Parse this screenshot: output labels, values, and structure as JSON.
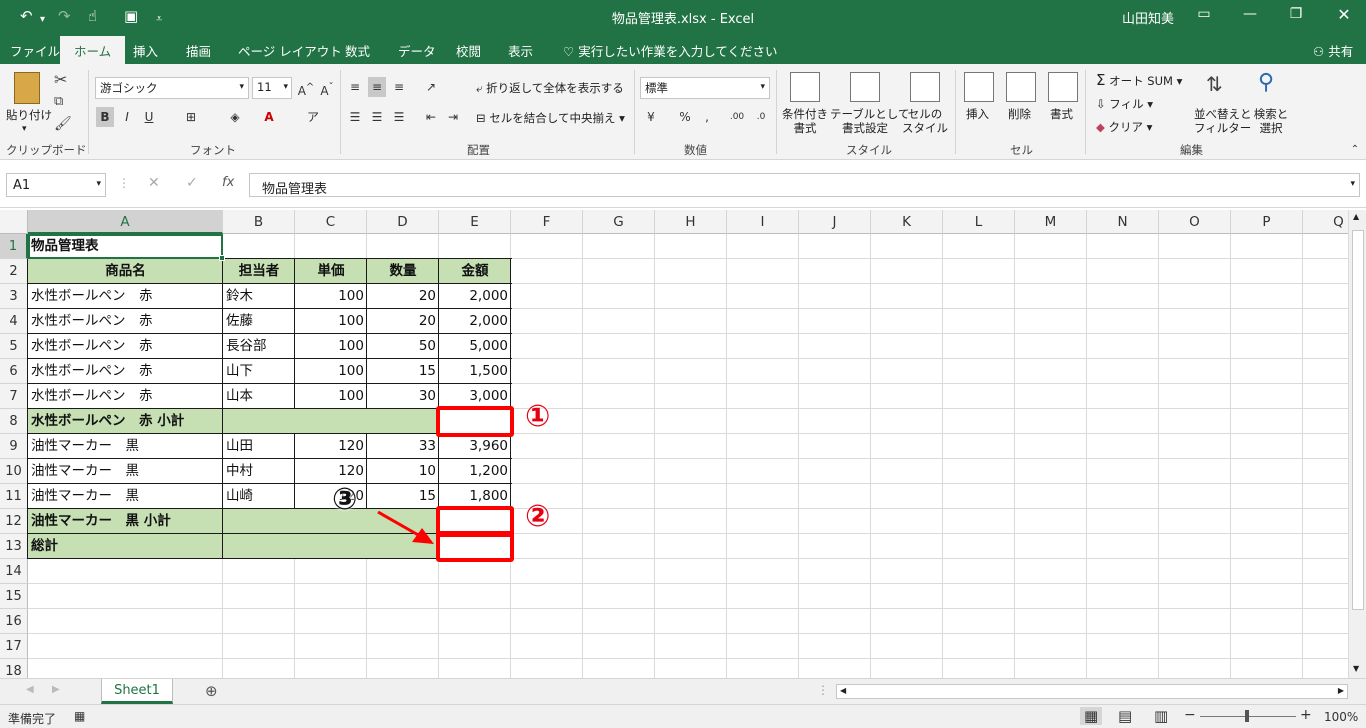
{
  "window": {
    "title": "物品管理表.xlsx  -  Excel",
    "user": "山田知美"
  },
  "tabs": {
    "items": [
      "ファイル",
      "ホーム",
      "挿入",
      "描画",
      "ページ レイアウト",
      "数式",
      "データ",
      "校閲",
      "表示"
    ],
    "active": "ホーム",
    "tell_me": "実行したい作業を入力してください",
    "share": "共有"
  },
  "ribbon": {
    "clipboard": {
      "paste": "貼り付け",
      "label": "クリップボード"
    },
    "font": {
      "name": "游ゴシック",
      "size": "11",
      "label": "フォント"
    },
    "alignment": {
      "wrap": "折り返して全体を表示する",
      "merge": "セルを結合して中央揃え",
      "label": "配置"
    },
    "number": {
      "format": "標準",
      "label": "数値"
    },
    "styles": {
      "conditional": [
        "条件付き",
        "書式"
      ],
      "table": [
        "テーブルとして",
        "書式設定"
      ],
      "cell": [
        "セルの",
        "スタイル"
      ],
      "label": "スタイル"
    },
    "cells": {
      "insert": "挿入",
      "delete": "削除",
      "format": "書式",
      "label": "セル"
    },
    "editing": {
      "autosum": "オート SUM",
      "fill": "フィル",
      "clear": "クリア",
      "sort": [
        "並べ替えと",
        "フィルター"
      ],
      "find": [
        "検索と",
        "選択"
      ],
      "label": "編集"
    }
  },
  "formula_bar": {
    "name_box": "A1",
    "content": "物品管理表"
  },
  "columns": [
    "A",
    "B",
    "C",
    "D",
    "E",
    "F",
    "G",
    "H",
    "I",
    "J",
    "K",
    "L",
    "M",
    "N",
    "O",
    "P",
    "Q"
  ],
  "rows": [
    "1",
    "2",
    "3",
    "4",
    "5",
    "6",
    "7",
    "8",
    "9",
    "10",
    "11",
    "12",
    "13",
    "14",
    "15",
    "16",
    "17",
    "18"
  ],
  "sheet": {
    "title": "物品管理表",
    "headers": [
      "商品名",
      "担当者",
      "単価",
      "数量",
      "金額"
    ],
    "records": [
      {
        "item": "水性ボールペン　赤",
        "person": "鈴木",
        "price": "100",
        "qty": "20",
        "amount": "2,000"
      },
      {
        "item": "水性ボールペン　赤",
        "person": "佐藤",
        "price": "100",
        "qty": "20",
        "amount": "2,000"
      },
      {
        "item": "水性ボールペン　赤",
        "person": "長谷部",
        "price": "100",
        "qty": "50",
        "amount": "5,000"
      },
      {
        "item": "水性ボールペン　赤",
        "person": "山下",
        "price": "100",
        "qty": "15",
        "amount": "1,500"
      },
      {
        "item": "水性ボールペン　赤",
        "person": "山本",
        "price": "100",
        "qty": "30",
        "amount": "3,000"
      },
      {
        "item": "水性ボールペン　赤 小計",
        "person": "",
        "price": "",
        "qty": "",
        "amount": ""
      },
      {
        "item": "油性マーカー　黒",
        "person": "山田",
        "price": "120",
        "qty": "33",
        "amount": "3,960"
      },
      {
        "item": "油性マーカー　黒",
        "person": "中村",
        "price": "120",
        "qty": "10",
        "amount": "1,200"
      },
      {
        "item": "油性マーカー　黒",
        "person": "山崎",
        "price": "120",
        "qty": "15",
        "amount": "1,800"
      },
      {
        "item": "油性マーカー　黒 小計",
        "person": "",
        "price": "",
        "qty": "",
        "amount": ""
      },
      {
        "item": "総計",
        "person": "",
        "price": "",
        "qty": "",
        "amount": ""
      }
    ]
  },
  "annotations": {
    "one": "①",
    "two": "②",
    "three": "③"
  },
  "sheet_tab": "Sheet1",
  "status": {
    "ready": "準備完了",
    "zoom": "100%"
  },
  "colors": {
    "excel_green": "#217346",
    "header_fill": "#c6e0b4",
    "annotation_red": "#ff0000"
  }
}
